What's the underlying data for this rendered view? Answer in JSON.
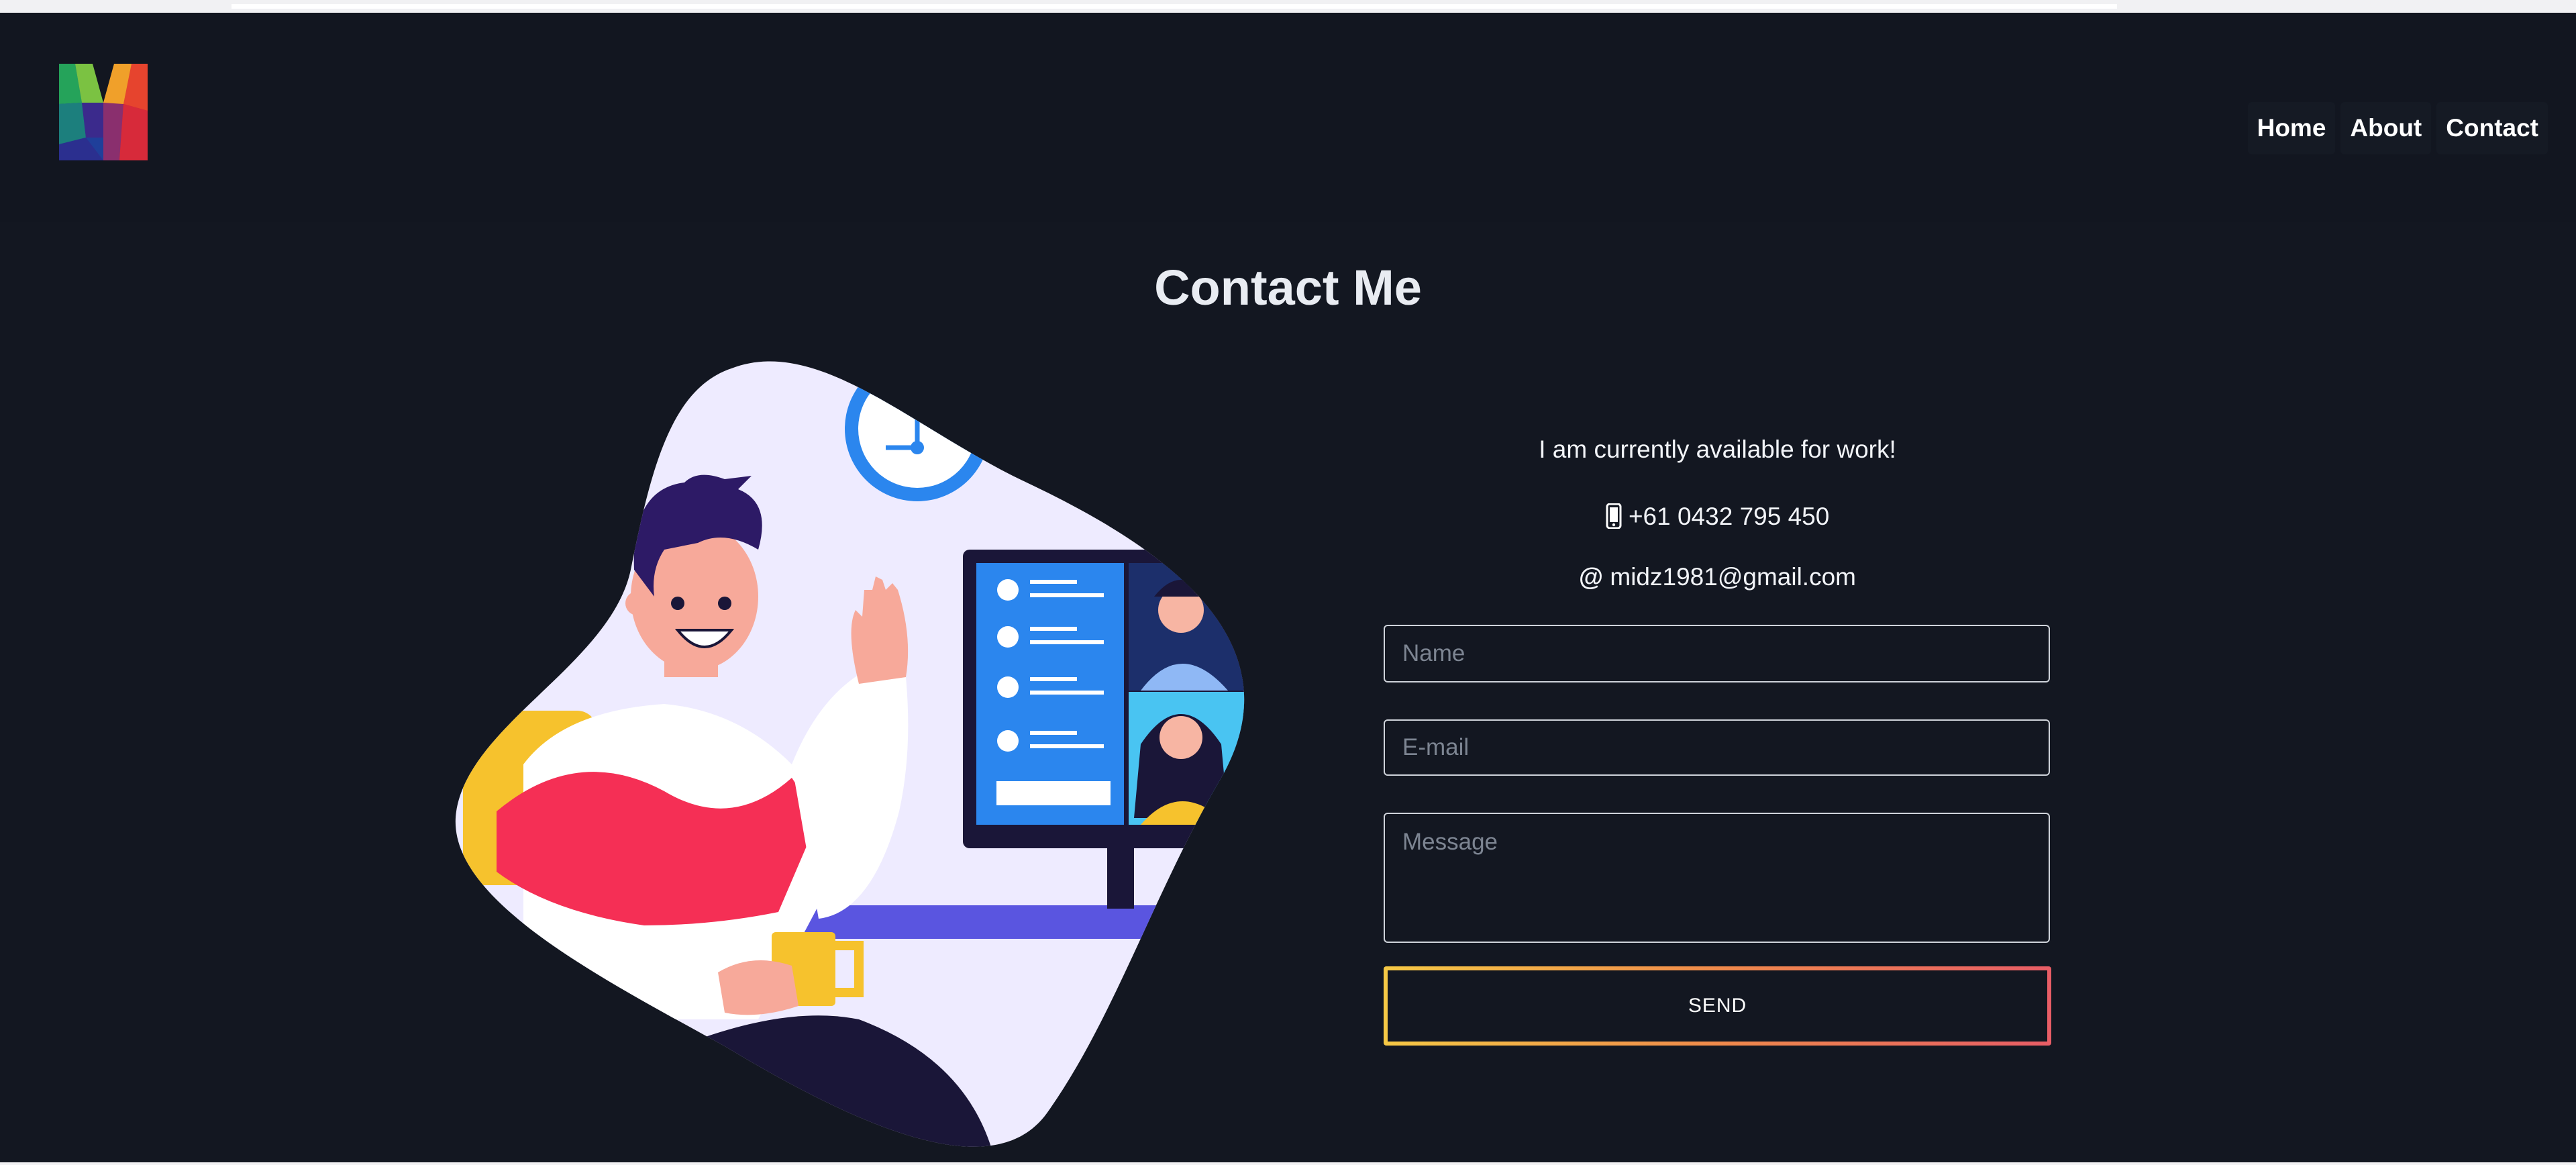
{
  "nav": {
    "items": [
      {
        "label": "Home"
      },
      {
        "label": "About"
      },
      {
        "label": "Contact"
      }
    ]
  },
  "page": {
    "title": "Contact Me"
  },
  "contact": {
    "availability": "I am currently available for work!",
    "phone": "+61 0432 795 450",
    "email": "midz1981@gmail.com"
  },
  "form": {
    "name_placeholder": "Name",
    "email_placeholder": "E-mail",
    "message_placeholder": "Message",
    "send_label": "SEND"
  },
  "icons": {
    "logo": "logo-m-icon",
    "phone": "mobile-phone-icon",
    "email": "at-sign-icon"
  },
  "colors": {
    "background": "#131721",
    "header": "#121620",
    "send_gradient": [
      "#f6c945",
      "#e85d66"
    ],
    "illustration_blob": "#eeebff",
    "accent_blue": "#2b86ee"
  }
}
